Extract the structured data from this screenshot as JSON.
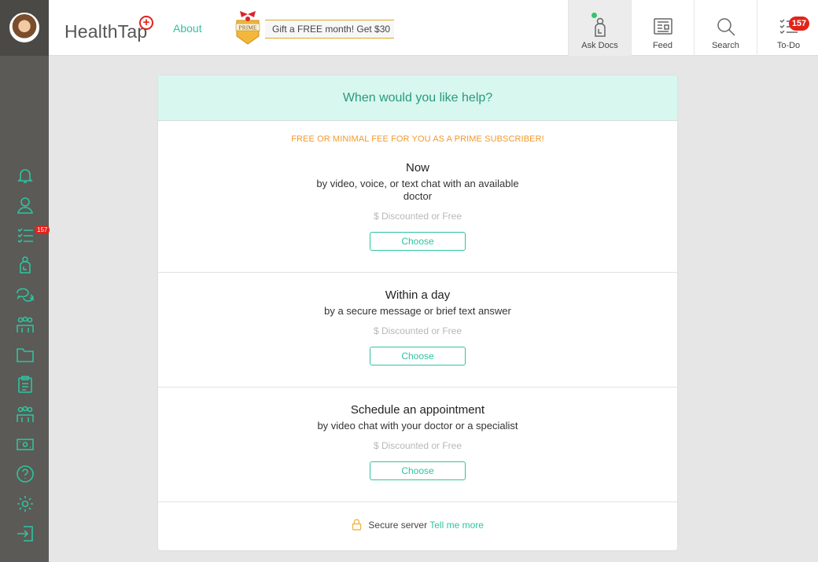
{
  "topbar": {
    "logo": "HealthTap",
    "about_label": "About",
    "prime_label": "PRIME",
    "gift_text": "Gift a FREE month! Get $30",
    "nav": [
      {
        "label": "Ask Docs",
        "icon": "doctor-icon"
      },
      {
        "label": "Feed",
        "icon": "feed-icon"
      },
      {
        "label": "Search",
        "icon": "search-icon"
      },
      {
        "label": "To-Do",
        "icon": "todo-list-icon",
        "badge": "157"
      }
    ]
  },
  "sidebar": {
    "todo_badge": "157",
    "icons": [
      "bell-icon",
      "user-icon",
      "todo-list-icon",
      "doctor-icon",
      "chat-icon",
      "group-icon",
      "folder-icon",
      "clipboard-icon",
      "community-icon",
      "money-icon",
      "help-icon",
      "settings-icon",
      "logout-icon"
    ]
  },
  "card": {
    "header": "When would you like help?",
    "promo": "FREE OR MINIMAL FEE FOR YOU AS A PRIME SUBSCRIBER!",
    "options": [
      {
        "title": "Now",
        "desc_line1": "by video, voice, or text chat with an available",
        "desc_line2": "doctor",
        "price": "$ Discounted or Free",
        "button": "Choose"
      },
      {
        "title": "Within a day",
        "desc_line1": "by a secure message or brief text answer",
        "desc_line2": "",
        "price": "$ Discounted or Free",
        "button": "Choose"
      },
      {
        "title": "Schedule an appointment",
        "desc_line1": "by video chat with your doctor or a specialist",
        "desc_line2": "",
        "price": "$ Discounted or Free",
        "button": "Choose"
      }
    ],
    "secure_text": "Secure server",
    "secure_link": "Tell me more"
  },
  "colors": {
    "accent": "#2ec4a0",
    "promo": "#f29a2c",
    "badge": "#e2231a",
    "sidebar": "#5b5a56"
  }
}
